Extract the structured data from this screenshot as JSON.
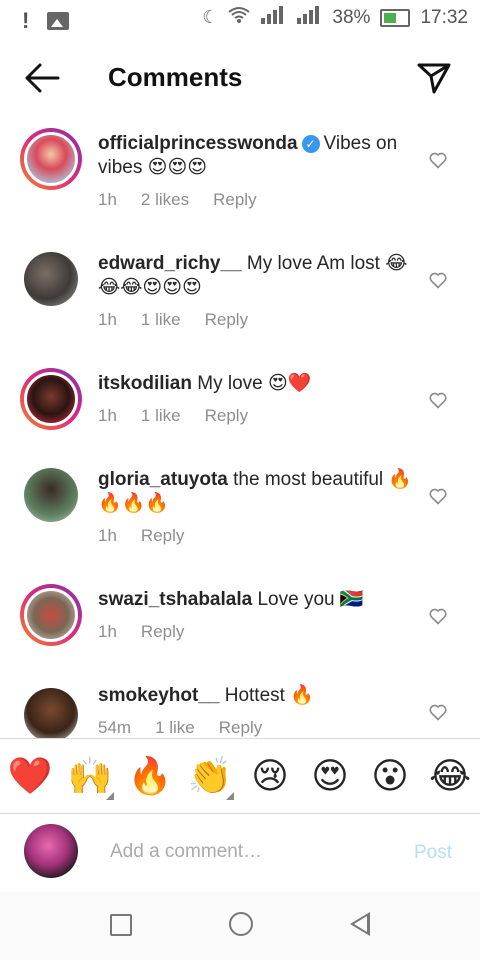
{
  "status_bar": {
    "battery": "38%",
    "time": "17:32",
    "signal_1": "H",
    "signal_2": "H"
  },
  "header": {
    "title": "Comments"
  },
  "comments": [
    {
      "username": "officialprincesswonda",
      "verified": true,
      "text": "Vibes on vibes 😍😍😍",
      "time": "1h",
      "likes": "2 likes",
      "reply": "Reply"
    },
    {
      "username": "edward_richy__",
      "verified": false,
      "text": "My love Am lost 😂😂😂😍😍😍",
      "time": "1h",
      "likes": "1 like",
      "reply": "Reply"
    },
    {
      "username": "itskodilian",
      "verified": false,
      "text": "My love 😍❤️",
      "time": "1h",
      "likes": "1 like",
      "reply": "Reply"
    },
    {
      "username": "gloria_atuyota",
      "verified": false,
      "text": "the most beautiful 🔥🔥🔥🔥",
      "time": "1h",
      "likes": "",
      "reply": "Reply"
    },
    {
      "username": "swazi_tshabalala",
      "verified": false,
      "text": "Love you 🇿🇦",
      "time": "1h",
      "likes": "",
      "reply": "Reply"
    },
    {
      "username": "smokeyhot__",
      "verified": false,
      "text": "Hottest 🔥",
      "time": "54m",
      "likes": "1 like",
      "reply": "Reply"
    }
  ],
  "emoji_bar": [
    "❤️",
    "🙌",
    "🔥",
    "👏",
    "😢",
    "😍",
    "😮",
    "😂"
  ],
  "compose": {
    "placeholder": "Add a comment…",
    "post_label": "Post"
  },
  "colors": {
    "verified": "#3897f0",
    "post_disabled": "#b2dffc",
    "meta_text": "#8e8e8e"
  }
}
